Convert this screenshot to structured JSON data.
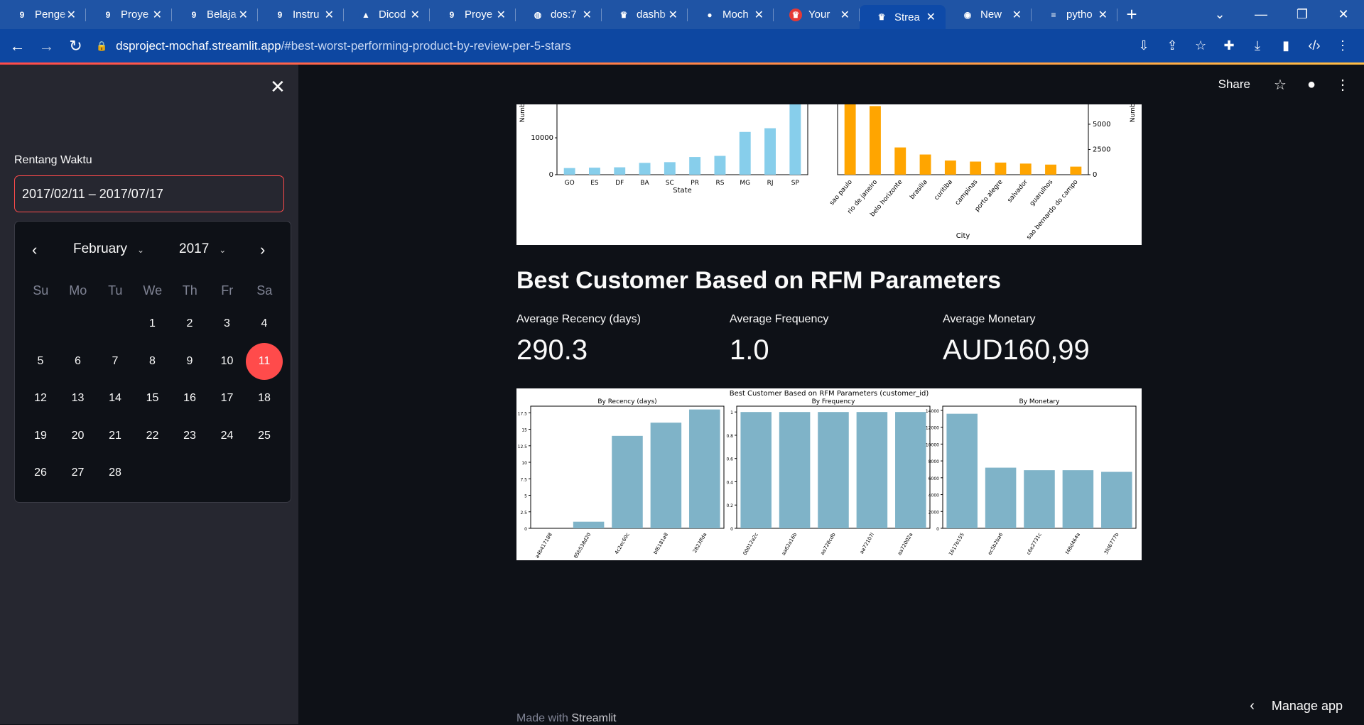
{
  "browser": {
    "tabs": [
      {
        "title": "Penge",
        "icon": "9",
        "icon_bg": "#1f54a5"
      },
      {
        "title": "Proye",
        "icon": "9",
        "icon_bg": "#1f54a5"
      },
      {
        "title": "Belaja",
        "icon": "9",
        "icon_bg": "#1f54a5"
      },
      {
        "title": "Instru",
        "icon": "9",
        "icon_bg": "#1f54a5"
      },
      {
        "title": "Dicod",
        "icon": "▲",
        "icon_bg": "#1f54a5"
      },
      {
        "title": "Proye",
        "icon": "9",
        "icon_bg": "#1f54a5"
      },
      {
        "title": "dos:7",
        "icon": "◍",
        "icon_bg": "#1f54a5"
      },
      {
        "title": "dashb",
        "icon": "♛",
        "icon_bg": "#1f54a5"
      },
      {
        "title": "Moch",
        "icon": "●",
        "icon_bg": "#1f54a5"
      },
      {
        "title": "Your",
        "icon": "♛",
        "icon_bg": "#e53935"
      },
      {
        "title": "Strea",
        "icon": "♛",
        "icon_bg": "#0e4aa8",
        "active": true
      },
      {
        "title": "New",
        "icon": "◉",
        "icon_bg": "#1f54a5"
      },
      {
        "title": "pytho",
        "icon": "≡",
        "icon_bg": "#1f54a5"
      }
    ],
    "tab_close": "✕",
    "new_tab": "+",
    "url_host": "dsproject-mochaf.streamlit.app",
    "url_path": "/#best-worst-performing-product-by-review-per-5-stars"
  },
  "sidebar": {
    "close": "✕",
    "date_label": "Rentang Waktu",
    "date_value": "2017/02/11 – 2017/07/17",
    "calendar": {
      "month": "February",
      "year": "2017",
      "weekdays": [
        "Su",
        "Mo",
        "Tu",
        "We",
        "Th",
        "Fr",
        "Sa"
      ],
      "first_weekday": 3,
      "days_in_month": 28,
      "selected_day": 11
    }
  },
  "toolbar": {
    "share": "Share"
  },
  "rfm": {
    "heading": "Best Customer Based on RFM Parameters",
    "metrics": [
      {
        "label": "Average Recency (days)",
        "value": "290.3"
      },
      {
        "label": "Average Frequency",
        "value": "1.0"
      },
      {
        "label": "Average Monetary",
        "value": "AUD160,99"
      }
    ]
  },
  "footer": {
    "prefix": "Made with ",
    "brand": "Streamlit"
  },
  "manage_app": "Manage app",
  "colors": {
    "accent": "#ff4b4b",
    "state_bar": "#87ceeb",
    "city_bar": "#ffa500",
    "rfm_bar": "#7fb3c8"
  },
  "chart_data": [
    {
      "type": "bar",
      "xlabel": "State",
      "ylabel": "Number of Cu",
      "ylim": [
        0,
        26000
      ],
      "yticks": [
        0,
        10000,
        20000
      ],
      "categories": [
        "GO",
        "ES",
        "DF",
        "BA",
        "SC",
        "PR",
        "RS",
        "MG",
        "RJ",
        "SP"
      ],
      "values": [
        1800,
        1900,
        2000,
        3200,
        3400,
        4800,
        5100,
        11600,
        12600,
        26000
      ]
    },
    {
      "type": "bar",
      "xlabel": "City",
      "ylabel": "Number of Cu",
      "ylim": [
        0,
        9500
      ],
      "yticks": [
        0,
        2500,
        5000,
        7500
      ],
      "categories": [
        "sao paulo",
        "rio de janeiro",
        "belo horizonte",
        "brasilia",
        "curitiba",
        "campinas",
        "porto alegre",
        "salvador",
        "guarulhos",
        "sao bernardo do campo"
      ],
      "values": [
        9500,
        6800,
        2700,
        2000,
        1400,
        1300,
        1200,
        1100,
        1000,
        800
      ]
    },
    {
      "type": "bar",
      "suptitle": "Best Customer Based on RFM Parameters (customer_id)",
      "title": "By Recency (days)",
      "ylim": [
        0,
        18.5
      ],
      "yticks": [
        0.0,
        2.5,
        5.0,
        7.5,
        10.0,
        12.5,
        15.0,
        17.5
      ],
      "categories": [
        "a4b417188",
        "85b538d20",
        "4c2ec60c",
        "bf6181a8",
        "2823ffda"
      ],
      "values": [
        0,
        1,
        14,
        16,
        18
      ]
    },
    {
      "type": "bar",
      "title": "By Frequency",
      "ylim": [
        0,
        1.05
      ],
      "yticks": [
        0.0,
        0.2,
        0.4,
        0.6,
        0.8,
        1.0
      ],
      "categories": [
        "00012a2c",
        "aa62a16b",
        "aa728cdb",
        "aa72107l",
        "aa72002a"
      ],
      "values": [
        1,
        1,
        1,
        1,
        1
      ]
    },
    {
      "type": "bar",
      "title": "By Monetary",
      "ylim": [
        0,
        14500
      ],
      "yticks": [
        0,
        2000,
        4000,
        6000,
        8000,
        10000,
        12000,
        14000
      ],
      "categories": [
        "1617b155",
        "ec5b2ba6",
        "c6e2731c",
        "f48d464a",
        "3fd6777b"
      ],
      "values": [
        13600,
        7200,
        6900,
        6900,
        6700
      ]
    }
  ]
}
